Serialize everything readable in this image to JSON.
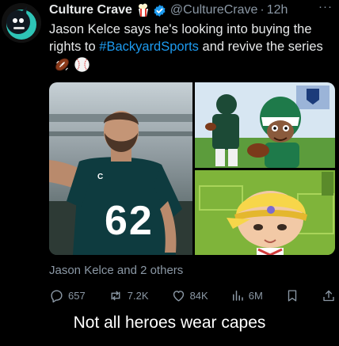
{
  "post": {
    "author": "Culture Crave",
    "handle": "@CultureCrave",
    "separator": "·",
    "time": "12h",
    "more": "···",
    "text_before": "Jason Kelce says he's looking into buying the rights to ",
    "hashtag": "#BackyardSports",
    "text_after": " and revive the series",
    "emojis": [
      "american-football-emoji",
      "baseball-emoji"
    ],
    "tagged": "Jason Kelce and 2 others"
  },
  "media": {
    "left_jersey_number": "62",
    "left_jersey_letter": "C"
  },
  "actions": {
    "replies": "657",
    "reposts": "7.2K",
    "likes": "84K",
    "views": "6M"
  },
  "caption": "Not all heroes wear capes",
  "colors": {
    "background": "#000000",
    "text": "#e7e9ea",
    "muted": "#8b98a5",
    "link": "#1d9bf0",
    "verified": "#1d9bf0"
  }
}
